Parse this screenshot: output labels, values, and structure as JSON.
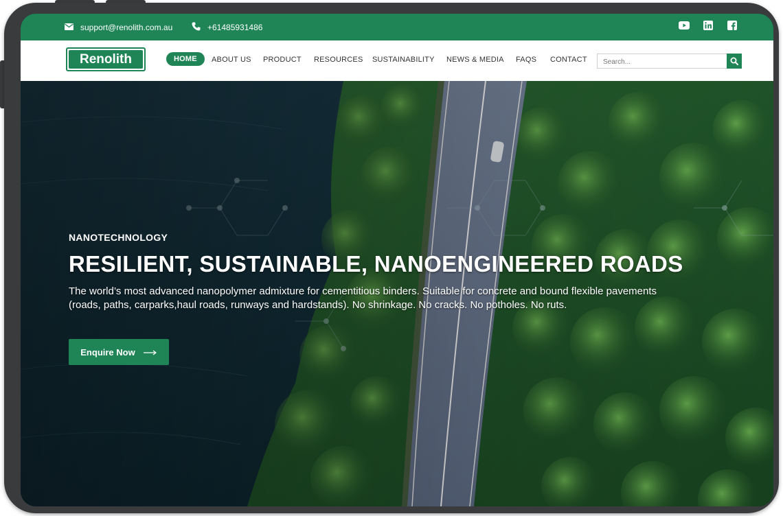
{
  "topbar": {
    "email": "support@renolith.com.au",
    "phone": "+61485931486",
    "icons": {
      "email": "envelope-icon",
      "phone": "phone-icon",
      "youtube": "youtube-icon",
      "linkedin": "linkedin-icon",
      "facebook": "facebook-icon"
    }
  },
  "brand": {
    "logo": "Renolith"
  },
  "nav": {
    "items": [
      {
        "label": "HOME",
        "active": true
      },
      {
        "label": "ABOUT US"
      },
      {
        "label": "PRODUCT"
      },
      {
        "label": "RESOURCES"
      },
      {
        "label": "SUSTAINABILITY"
      },
      {
        "label": "NEWS & MEDIA"
      },
      {
        "label": "FAQS"
      },
      {
        "label": "CONTACT"
      }
    ]
  },
  "search": {
    "placeholder": "Search..."
  },
  "hero": {
    "eyebrow": "NANOTECHNOLOGY",
    "title": "RESILIENT, SUSTAINABLE, NANOENGINEERED ROADS",
    "subtitle": "The world’s most advanced nanopolymer admixture for cementitious binders. Suitable for concrete and bound flexible pavements (roads, paths, carparks,haul roads, runways and hardstands). No shrinkage. No cracks. No potholes. No ruts.",
    "cta": "Enquire Now"
  },
  "colors": {
    "brand_green": "#1f8456",
    "device_frame": "#3a3b3d"
  }
}
